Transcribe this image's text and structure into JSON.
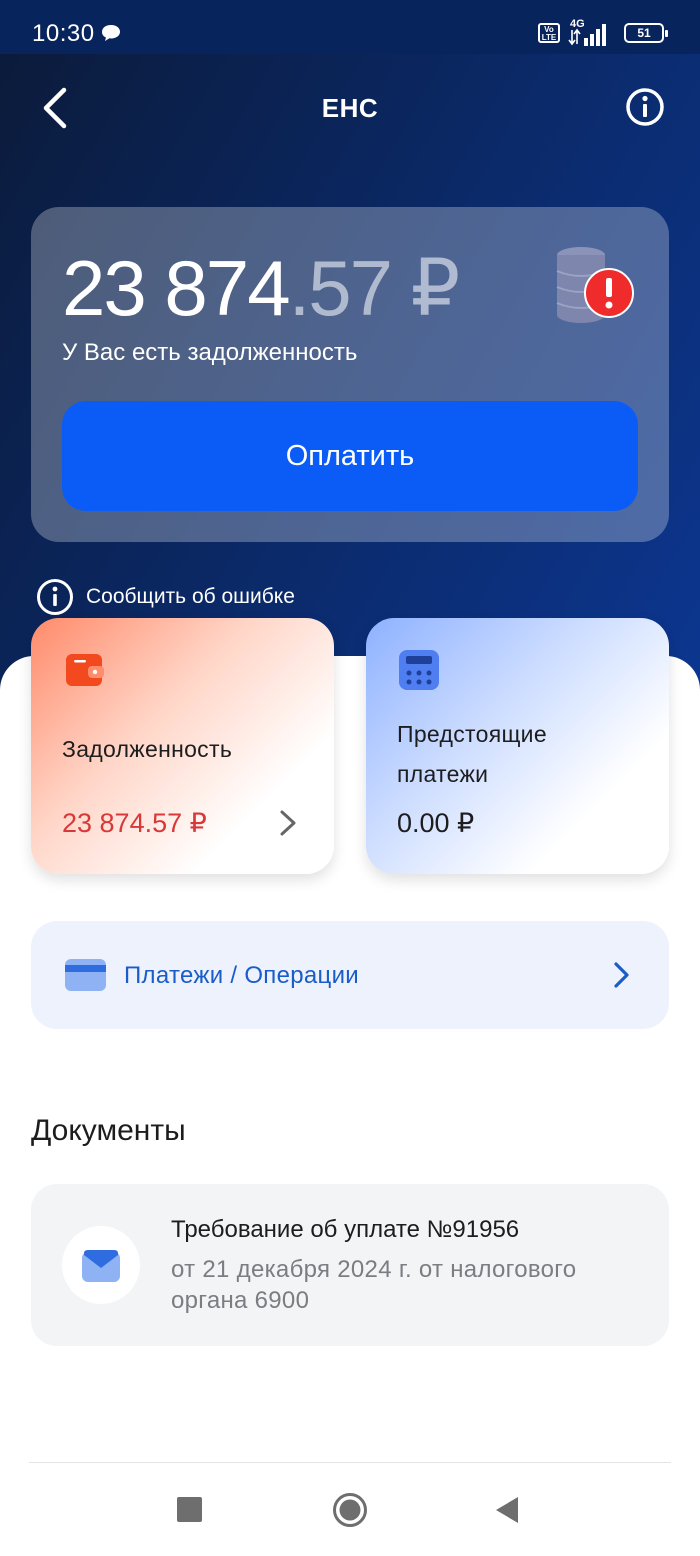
{
  "status_bar": {
    "time": "10:30",
    "volte": "Vo LTE",
    "network": "4G",
    "battery": "51"
  },
  "header": {
    "title": "ЕНС"
  },
  "balance": {
    "amount_integer": "23 874",
    "amount_decimal": ".57 ₽",
    "message": "У Вас есть задолженность",
    "pay_label": "Оплатить"
  },
  "report_error": {
    "label": "Сообщить об ошибке"
  },
  "tiles": {
    "debt": {
      "label": "Задолженность",
      "amount": "23 874.57 ₽"
    },
    "upcoming": {
      "label": "Предстоящие платежи",
      "amount": "0.00 ₽"
    }
  },
  "operations": {
    "label": "Платежи / Операции"
  },
  "documents": {
    "title": "Документы",
    "items": [
      {
        "title": "Требование об уплате №91956",
        "subtitle": "от 21 декабря 2024 г. от налогового органа 6900"
      }
    ]
  },
  "colors": {
    "accent_blue": "#0b5cf7",
    "debt_red": "#d93838",
    "link_blue": "#1a5cc8"
  }
}
